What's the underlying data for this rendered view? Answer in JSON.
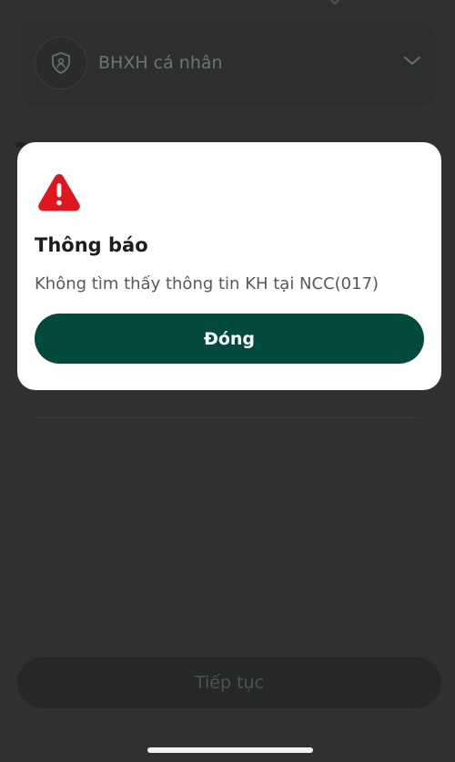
{
  "background": {
    "service_selector": {
      "label": "BHXH cá nhân",
      "icon": "shield-icon",
      "chevron": "chevron-down-icon"
    },
    "continue_button_label": "Tiếp tục"
  },
  "modal": {
    "icon": "warning-icon",
    "title": "Thông báo",
    "message": "Không tìm thấy thông tin KH tại NCC(017)",
    "close_button_label": "Đóng"
  },
  "colors": {
    "overlay_bg": "#2f3131",
    "modal_bg": "#ffffff",
    "primary_button": "#024a3d",
    "warning_red": "#e0161e"
  }
}
